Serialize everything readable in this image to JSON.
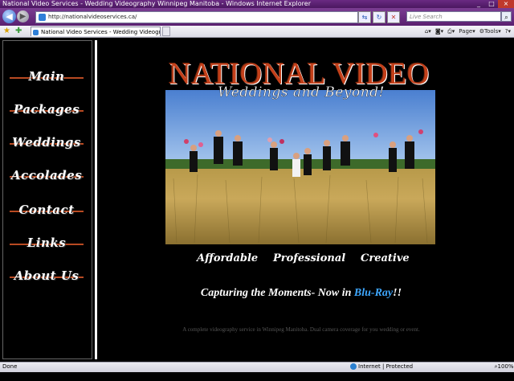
{
  "browser": {
    "window_title": "National Video Services - Wedding Videography Winnipeg Manitoba - Windows Internet Explorer",
    "address": "http://nationalvideoservices.ca/",
    "search_placeholder": "Live Search",
    "tab_title": "National Video Services - Wedding Videography ...",
    "commands": {
      "page": "Page",
      "tools": "Tools"
    },
    "status": {
      "left": "Done",
      "zone": "Internet | Protected Mode: On",
      "zoom": "100%"
    }
  },
  "site": {
    "nav": [
      "Main",
      "Packages",
      "Weddings",
      "Accolades",
      "Contact",
      "Links",
      "About Us"
    ],
    "banner_title": "NATIONAL VIDEO",
    "tagline": "Weddings and Beyond!",
    "values": [
      "Affordable",
      "Professional",
      "Creative"
    ],
    "capture_prefix": "Capturing the Moments- Now in ",
    "capture_highlight": "Blu-Ray",
    "capture_suffix": "!!",
    "description": "A complete videography service in Winnipeg Manitoba.  Dual camera coverage for you wedding or event."
  },
  "colors": {
    "accent": "#c4401a",
    "blu_ray": "#3ea7ff",
    "nav_strike": "#b84a22",
    "chrome": "#5a2070"
  }
}
